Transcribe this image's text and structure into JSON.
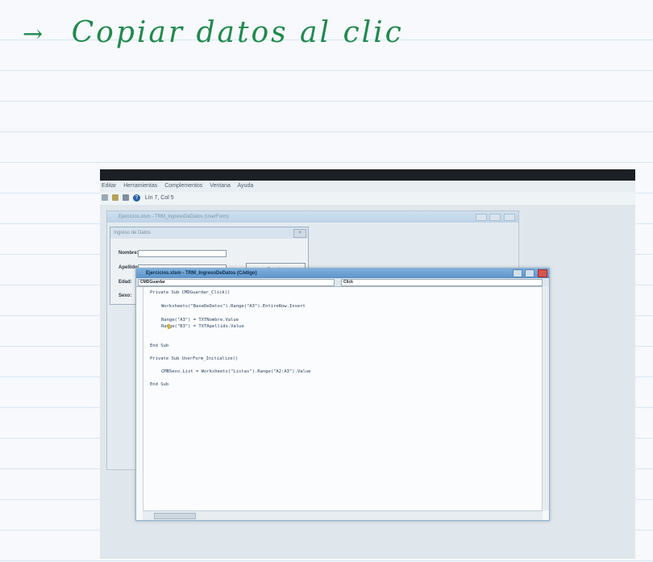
{
  "note": {
    "arrow": "→",
    "text": "Copiar datos al clic",
    "color": "#1f8a4c"
  },
  "vbe": {
    "menu": [
      "Editar",
      "Herramientas",
      "Complementos",
      "Ventana",
      "Ayuda"
    ],
    "status": "Lín 7, Col 5",
    "form_window_title": "Ejercicios.xlsm - TRM_IngresoDeDatos (UserForm)",
    "userform": {
      "title": "Ingreso de Datos",
      "labels": {
        "nombre": "Nombre:",
        "apellido": "Apellido:",
        "edad": "Edad:",
        "sexo": "Sexo:"
      },
      "button": "Guardar"
    },
    "code_window": {
      "title": "Ejercicios.xlsm - TRM_IngresoDeDatos (Código)",
      "object_combo": "CMDGuardar",
      "proc_combo": "Click",
      "lines": [
        "Private Sub CMDGuardar_Click()",
        "Worksheets(\"BaseDeDatos\").Range(\"A3\").EntireRow.Insert",
        "Range(\"A3\") = TXTNombre.Value",
        "Range(\"B3\") = TXTApellido.Value",
        "End Sub",
        "Private Sub UserForm_Initialize()",
        "CMBSexo.List = Worksheets(\"Listas\").Range(\"A2:A3\").Value",
        "End Sub"
      ]
    }
  }
}
